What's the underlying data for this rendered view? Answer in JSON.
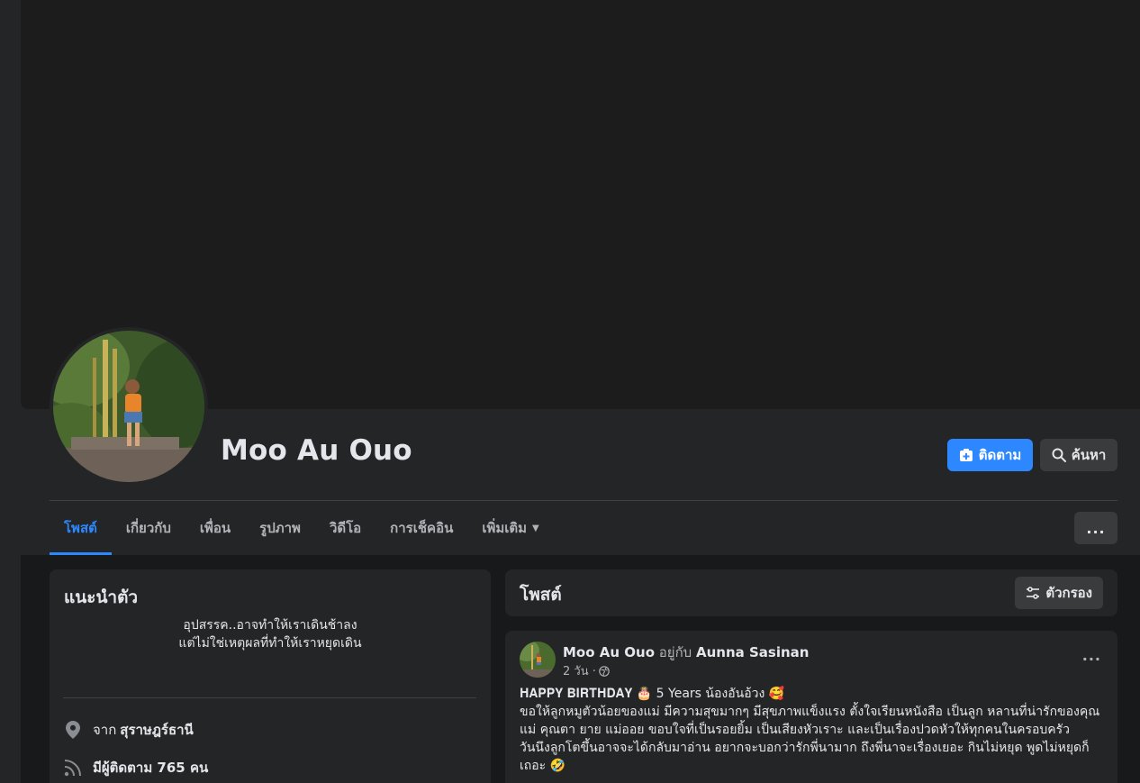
{
  "profile": {
    "name": "Moo Au Ouo"
  },
  "actions": {
    "follow_label": "ติดตาม",
    "search_label": "ค้นหา"
  },
  "tabs": [
    {
      "label": "โพสต์",
      "active": true
    },
    {
      "label": "เกี่ยวกับ"
    },
    {
      "label": "เพื่อน"
    },
    {
      "label": "รูปภาพ"
    },
    {
      "label": "วิดีโอ"
    },
    {
      "label": "การเช็คอิน"
    },
    {
      "label": "เพิ่มเติม"
    }
  ],
  "more_menu_label": "...",
  "intro": {
    "title": "แนะนำตัว",
    "bio_line1": "อุปสรรค..อาจทำให้เราเดินช้าลง",
    "bio_line2": "แต่ไม่ใช่เหตุผลที่ทำให้เราหยุดเดิน",
    "from_prefix": "จาก",
    "from_place": "สุราษฎร์ธานี",
    "followers_text": "มีผู้ติดตาม 765 คน"
  },
  "posts": {
    "title": "โพสต์",
    "filter_label": "ตัวกรอง"
  },
  "post": {
    "author": "Moo Au Ouo",
    "with_text": "อยู่กับ",
    "tagged": "Aunna Sasinan",
    "time": "2 วัน ·",
    "menu_label": "...",
    "line1": "𝐇𝐀𝐏𝐏𝐘 𝐁𝐈𝐑𝐓𝐇𝐃𝐀𝐘 🎂  5 Years น้องอันอ้วง 🥰",
    "line2": "     ขอให้ลูกหมูตัวน้อยของแม่ มีความสุขมากๆ มีสุขภาพแข็งแรง ตั้งใจเรียนหนังสือ เป็นลูก หลานที่น่ารักของคุณแม่ คุณตา ยาย แม่ออย ขอบใจที่เป็นรอยยิ้ม เป็นเสียงหัวเราะ และเป็นเรื่องปวดหัวให้ทุกคนในครอบครัว",
    "line3": "     วันนึงลูกโตขึ้นอาจจะได้กลับมาอ่าน อยากจะบอกว่ารักพี่นามาก ถึงพี่นาจะเรื่องเยอะ กินไม่หยุด พูดไม่หยุดก็เถอะ 🤣"
  },
  "colors": {
    "accent": "#2d88ff",
    "background": "#18191a",
    "surface": "#242526",
    "button_secondary": "#3a3b3c"
  },
  "icons": {
    "follow": "add-friend-icon",
    "search": "search-icon",
    "filter": "filter-icon",
    "location": "location-pin-icon",
    "followers": "rss-feed-icon",
    "privacy": "globe-icon"
  }
}
